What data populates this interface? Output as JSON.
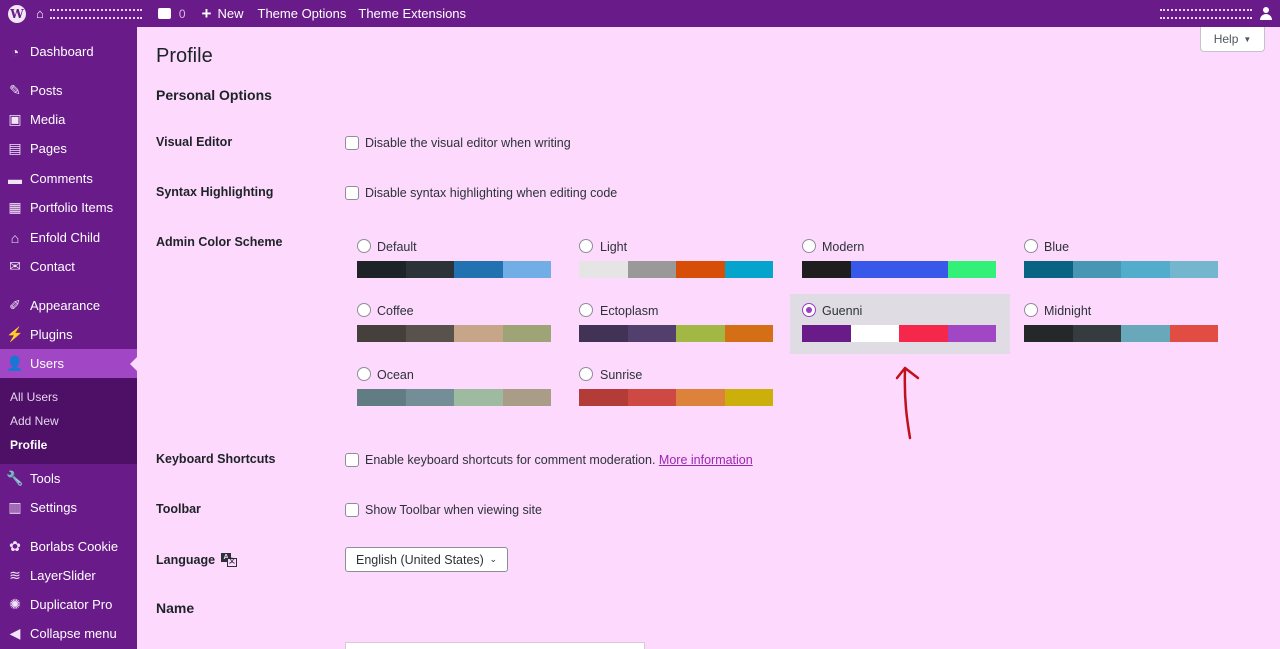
{
  "adminbar": {
    "comments_count": "0",
    "new_label": "New",
    "theme_options": "Theme Options",
    "theme_extensions": "Theme Extensions"
  },
  "sidebar": {
    "items": [
      {
        "label": "Dashboard",
        "icon": "dashboard-icon"
      },
      {
        "label": "Posts",
        "icon": "pin-icon"
      },
      {
        "label": "Media",
        "icon": "media-icon"
      },
      {
        "label": "Pages",
        "icon": "pages-icon"
      },
      {
        "label": "Comments",
        "icon": "comment-icon"
      },
      {
        "label": "Portfolio Items",
        "icon": "portfolio-icon"
      },
      {
        "label": "Enfold Child",
        "icon": "home-icon"
      },
      {
        "label": "Contact",
        "icon": "mail-icon"
      },
      {
        "label": "Appearance",
        "icon": "brush-icon"
      },
      {
        "label": "Plugins",
        "icon": "plug-icon"
      },
      {
        "label": "Users",
        "icon": "user-icon"
      },
      {
        "label": "Tools",
        "icon": "wrench-icon"
      },
      {
        "label": "Settings",
        "icon": "settings-icon"
      },
      {
        "label": "Borlabs Cookie",
        "icon": "cookie-icon"
      },
      {
        "label": "LayerSlider",
        "icon": "layers-icon"
      },
      {
        "label": "Duplicator Pro",
        "icon": "duplicator-icon"
      },
      {
        "label": "Collapse menu",
        "icon": "collapse-icon"
      }
    ],
    "submenu": [
      "All Users",
      "Add New",
      "Profile"
    ]
  },
  "page": {
    "title": "Profile",
    "help": "Help",
    "personal_options": "Personal Options",
    "name_section": "Name"
  },
  "fields": {
    "visual_editor": {
      "label": "Visual Editor",
      "text": "Disable the visual editor when writing"
    },
    "syntax": {
      "label": "Syntax Highlighting",
      "text": "Disable syntax highlighting when editing code"
    },
    "color_scheme": {
      "label": "Admin Color Scheme"
    },
    "keyboard": {
      "label": "Keyboard Shortcuts",
      "text": "Enable keyboard shortcuts for comment moderation.",
      "link": "More information"
    },
    "toolbar": {
      "label": "Toolbar",
      "text": "Show Toolbar when viewing site"
    },
    "language": {
      "label": "Language",
      "value": "English (United States)"
    }
  },
  "schemes": [
    {
      "name": "Default",
      "colors": [
        "#1d2327",
        "#2c3338",
        "#2271b1",
        "#72aee6"
      ],
      "selected": false
    },
    {
      "name": "Light",
      "colors": [
        "#e5e5e5",
        "#999999",
        "#d64e07",
        "#04a4cc"
      ],
      "selected": false
    },
    {
      "name": "Modern",
      "colors": [
        "#1e1e1e",
        "#3858e9",
        "#3858e9",
        "#33f078"
      ],
      "selected": false
    },
    {
      "name": "Blue",
      "colors": [
        "#096484",
        "#4796b3",
        "#52accc",
        "#74b6ce"
      ],
      "selected": false
    },
    {
      "name": "Coffee",
      "colors": [
        "#46403c",
        "#59524c",
        "#c7a589",
        "#9ea476"
      ],
      "selected": false
    },
    {
      "name": "Ectoplasm",
      "colors": [
        "#413256",
        "#523f6d",
        "#a3b745",
        "#d46f15"
      ],
      "selected": false
    },
    {
      "name": "Guenni",
      "colors": [
        "#6a1b8a",
        "#ffffff",
        "#f5274a",
        "#a147c5"
      ],
      "selected": true
    },
    {
      "name": "Midnight",
      "colors": [
        "#25282b",
        "#363b3f",
        "#69a8bb",
        "#e14d43"
      ],
      "selected": false
    },
    {
      "name": "Ocean",
      "colors": [
        "#627c83",
        "#738e96",
        "#9ebaa0",
        "#aa9d88"
      ],
      "selected": false
    },
    {
      "name": "Sunrise",
      "colors": [
        "#b43c38",
        "#cf4944",
        "#dd823b",
        "#ccaf0b"
      ],
      "selected": false
    }
  ],
  "theme": {
    "accent": "#6a1b8a",
    "background": "#fdd9fd",
    "active_menu": "#a147c5",
    "annotation_arrow": "#c0101a"
  }
}
